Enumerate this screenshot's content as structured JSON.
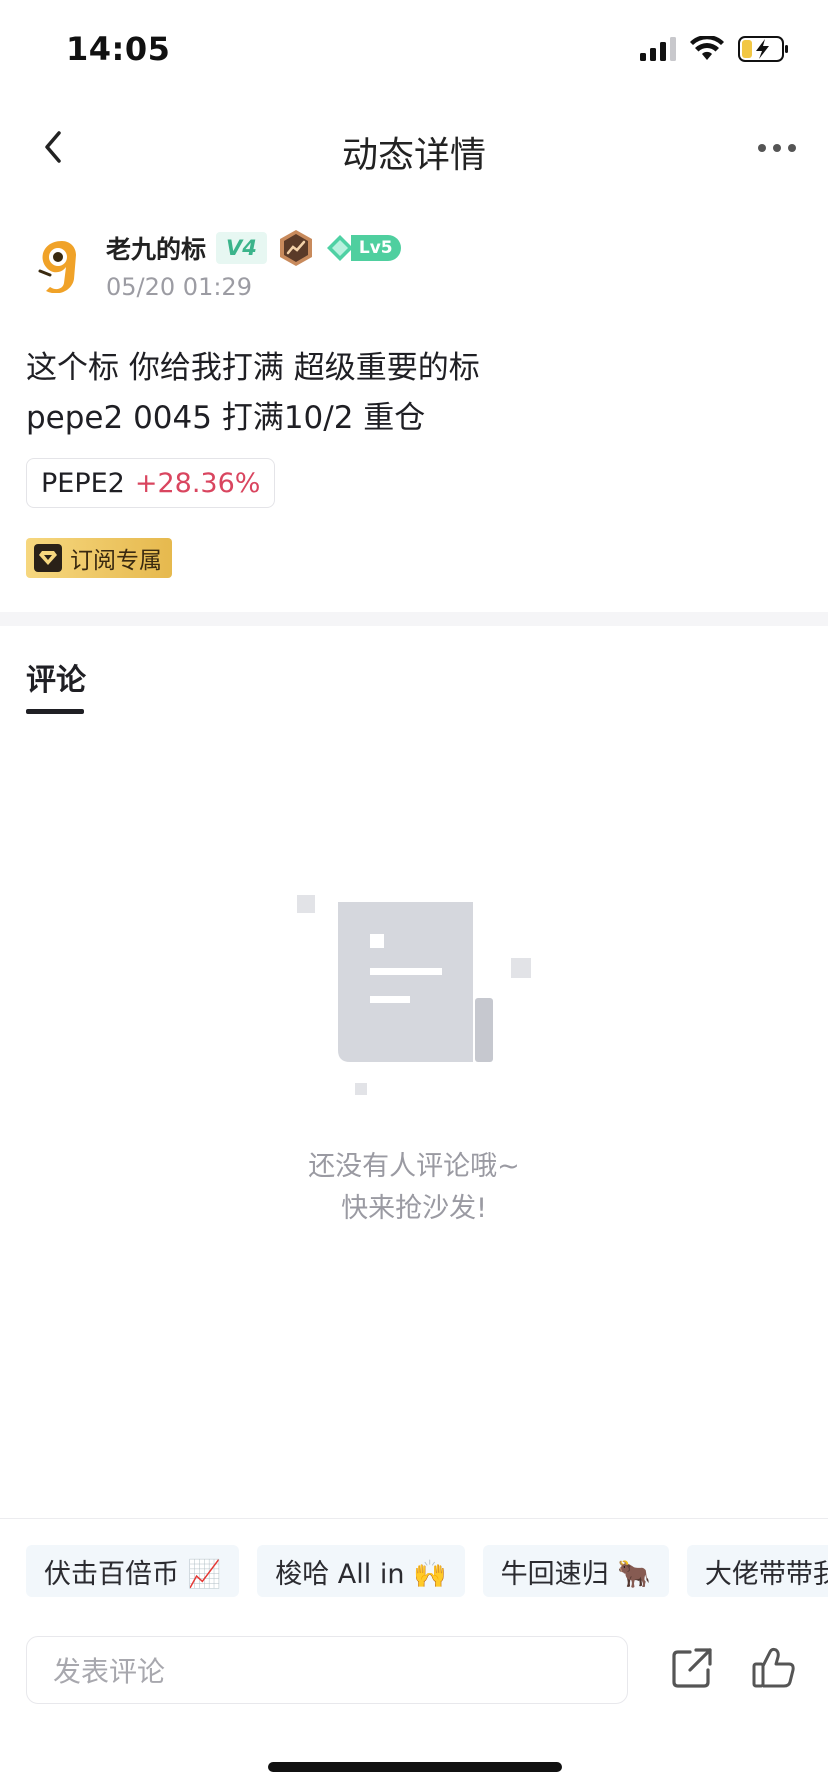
{
  "status_bar": {
    "time": "14:05",
    "icons": [
      "signal-icon",
      "wifi-icon",
      "battery-charging-icon"
    ]
  },
  "nav": {
    "title": "动态详情",
    "back_icon": "chevron-left-icon",
    "more_icon": "more-dots-icon"
  },
  "post": {
    "author": "老九的标",
    "verification_badge": "V4",
    "level_badge": "Lv5",
    "timestamp": "05/20 01:29",
    "body_line_1": "这个标 你给我打满 超级重要的标",
    "body_line_2": "pepe2 0045 打满10/2 重仓",
    "ticker": {
      "symbol": "PEPE2",
      "change": "+28.36%"
    },
    "tag": "订阅专属"
  },
  "comments": {
    "tab_label": "评论",
    "empty_line_1": "还没有人评论哦~",
    "empty_line_2": "快来抢沙发!"
  },
  "quick_replies": [
    {
      "label": "伏击百倍币 📈"
    },
    {
      "label": "梭哈 All in 🙌"
    },
    {
      "label": "牛回速归 🐂"
    },
    {
      "label": "大佬带带我"
    }
  ],
  "input": {
    "placeholder": "发表评论"
  },
  "colors": {
    "accent_green": "#3bb48b",
    "price_up": "#d9455f",
    "gold": "#e6b94e"
  }
}
